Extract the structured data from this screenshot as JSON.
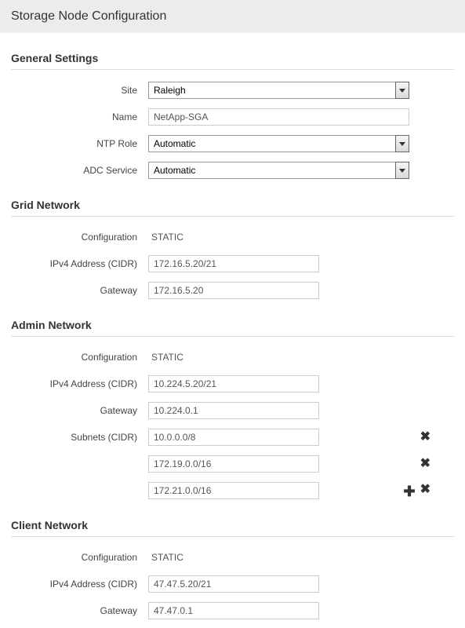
{
  "page": {
    "title": "Storage Node Configuration"
  },
  "sections": {
    "general": {
      "title": "General Settings",
      "site_label": "Site",
      "site_value": "Raleigh",
      "name_label": "Name",
      "name_value": "NetApp-SGA",
      "ntp_label": "NTP Role",
      "ntp_value": "Automatic",
      "adc_label": "ADC Service",
      "adc_value": "Automatic"
    },
    "grid": {
      "title": "Grid Network",
      "config_label": "Configuration",
      "config_value": "STATIC",
      "ipv4_label": "IPv4 Address (CIDR)",
      "ipv4_value": "172.16.5.20/21",
      "gateway_label": "Gateway",
      "gateway_value": "172.16.5.20"
    },
    "admin": {
      "title": "Admin Network",
      "config_label": "Configuration",
      "config_value": "STATIC",
      "ipv4_label": "IPv4 Address (CIDR)",
      "ipv4_value": "10.224.5.20/21",
      "gateway_label": "Gateway",
      "gateway_value": "10.224.0.1",
      "subnets_label": "Subnets (CIDR)",
      "subnets": {
        "0": "10.0.0.0/8",
        "1": "172.19.0.0/16",
        "2": "172.21.0.0/16"
      }
    },
    "client": {
      "title": "Client Network",
      "config_label": "Configuration",
      "config_value": "STATIC",
      "ipv4_label": "IPv4 Address (CIDR)",
      "ipv4_value": "47.47.5.20/21",
      "gateway_label": "Gateway",
      "gateway_value": "47.47.0.1"
    }
  },
  "icons": {
    "remove": "✖",
    "add": "✚"
  }
}
